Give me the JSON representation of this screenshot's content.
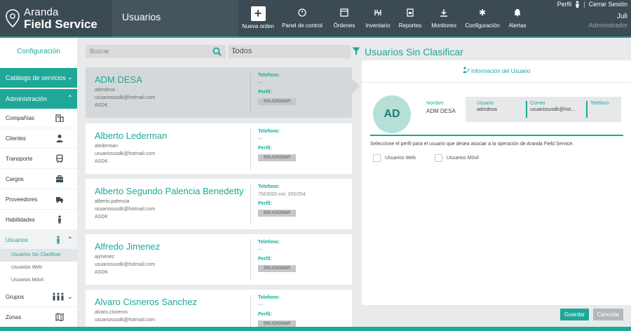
{
  "brand": {
    "line1": "Aranda",
    "line2": "Field Service"
  },
  "header": {
    "module_title": "Usuarios",
    "nav": [
      {
        "label": "Nueva orden",
        "icon": "plus-icon"
      },
      {
        "label": "Panel de control",
        "icon": "dashboard-icon"
      },
      {
        "label": "Órdenes",
        "icon": "orders-icon"
      },
      {
        "label": "Inventario",
        "icon": "inventory-icon"
      },
      {
        "label": "Reportes",
        "icon": "reports-icon"
      },
      {
        "label": "Monitoreo",
        "icon": "monitor-icon"
      },
      {
        "label": "Configuración",
        "icon": "gear-icon"
      },
      {
        "label": "Alertas",
        "icon": "bell-icon"
      }
    ],
    "user": {
      "perfil": "Perfil",
      "logout": "Cerrar Sesión",
      "name": "Juli",
      "role": "Administrador"
    }
  },
  "sidebar": {
    "title": "Configuración",
    "catalog": "Catálogo de servicios",
    "admin": "Administración",
    "items": [
      {
        "label": "Compañías",
        "icon": "building-icon"
      },
      {
        "label": "Clientes",
        "icon": "person-icon"
      },
      {
        "label": "Transporte",
        "icon": "bus-icon"
      },
      {
        "label": "Cargos",
        "icon": "briefcase-icon"
      },
      {
        "label": "Proveedores",
        "icon": "truck-icon"
      },
      {
        "label": "Habilidades",
        "icon": "skills-icon"
      },
      {
        "label": "Usuarios",
        "icon": "user-icon"
      }
    ],
    "subitems": [
      "Usuarios Sin Clasificar",
      "Usuarios Web",
      "Usuarios Móvil"
    ],
    "items2": [
      {
        "label": "Grupos",
        "icon": "group-icon"
      },
      {
        "label": "Zonas",
        "icon": "map-icon"
      }
    ]
  },
  "filters": {
    "search_placeholder": "Buscar",
    "select_value": "Todos"
  },
  "list": {
    "title": "Usuarios Sin Clasificar",
    "phone_label": "Telefono:",
    "profile_label": "Perfil:",
    "badge": "SIN ASIGNAR",
    "users": [
      {
        "name": "ADM DESA",
        "login": "admdesa",
        "email": "usuariosusdk@hotmail.com",
        "company": "ASDK",
        "phone": "---"
      },
      {
        "name": "Alberto Lederman",
        "login": "alederman",
        "email": "usuariosusdk@hotmail.com",
        "company": "ASDK",
        "phone": "---"
      },
      {
        "name": "Alberto Segundo Palencia Benedetty",
        "login": "alberto.palencia",
        "email": "usuariosusdk@hotmail.com",
        "company": "ASDK",
        "phone": "7563000 ext: 355/354"
      },
      {
        "name": "Alfredo Jimenez",
        "login": "ajimenez",
        "email": "usuariosusdk@hotmail.com",
        "company": "ASDK",
        "phone": "---"
      },
      {
        "name": "Alvaro Cisneros Sanchez",
        "login": "alvaro.cisneros",
        "email": "usuariosusdk@hotmail.com",
        "company": "",
        "phone": "---"
      }
    ]
  },
  "detail": {
    "header": "Información del Usuario",
    "initials": "AD",
    "nombre_label": "Nombre",
    "nombre": "ADM DESA",
    "usuario_label": "Usuario",
    "usuario": "admdesa",
    "correo_label": "Correo",
    "correo": "usuariosusdk@hot...",
    "telefono_label": "Teléfono",
    "telefono": "",
    "perfil_text": "Seleccione el perfil para el usuario que desea asociar a la operación de Aranda Field Service.",
    "option_web": "Usuarios Web",
    "option_movil": "Usuarios Móvil"
  },
  "actions": {
    "save": "Guardar",
    "cancel": "Cancelar"
  },
  "colors": {
    "accent": "#1da897",
    "header": "#3c4a54"
  }
}
